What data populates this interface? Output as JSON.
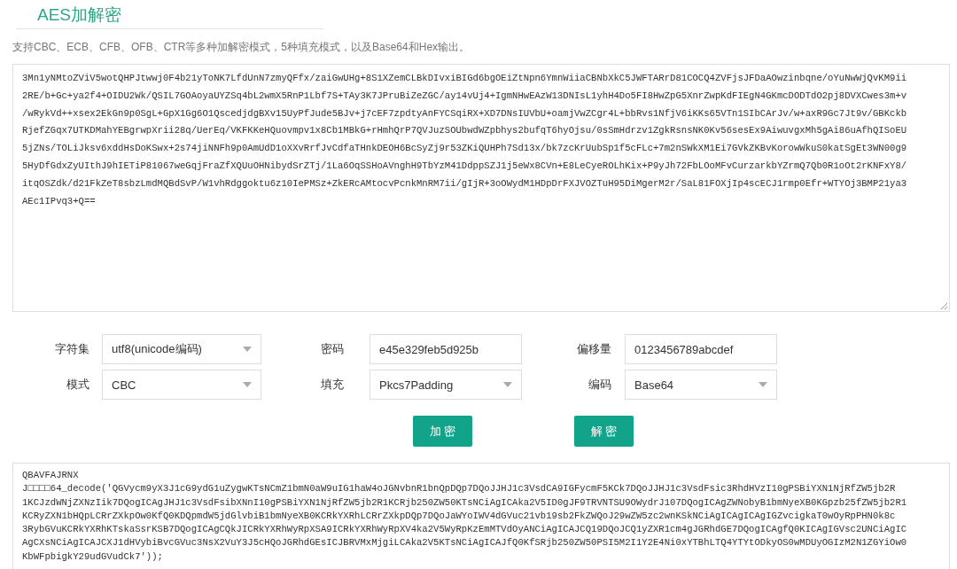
{
  "header": {
    "title": "AES加解密",
    "description": "支持CBC、ECB、CFB、OFB、CTR等多种加解密模式，5种填充模式，以及Base64和Hex输出。"
  },
  "input_text": [
    "3Mn1yNMtoZViV5wotQHPJtwwj0F4b21yToNK7LfdUnN7zmyQFfx/zaiGwUHg+8S1XZemCLBkDIvxiBIGd6bgOEiZtNpn6YmnWiiaCBNbXkC5JWFTARrD81COCQ4ZVFjsJFDaAOwzinbqne/oYuNwWjQvKM9ii",
    "2RE/b+Gc+ya2f4+OIDU2Wk/QSIL7GOAoyaUYZSq4bL2wmX5RnP1Lbf7S+TAy3K7JPruBiZeZGC/ay14vUj4+IgmNHwEAzW13DNIsL1yhH4Do5FI8HwZpG5XnrZwpKdFIEgN4GKmcDODTdO2pj8DVXCwes3m+v",
    "/wRykVd++xsex2EkGn9p0SgL+GpX1Gg6O1QscedjdgBXv15UyPfJude5BJv+j7cEF7zpdtyAnFYCSqiRX+XD7DNsIUVbU+oamjVwZCgr4L+bbRvs1NfjV6iKKs65VTn1SIbCArJv/w+axR9Gc7Jt9v/GBKckb",
    "RjefZGqx7UTKDMahYEBgrwpXrii28q/UerEq/VKFKKeHQuovmpv1x8Cb1MBkG+rHmhQrP7QVJuzSOUbwdWZpbhys2bufqT6hyOjsu/0sSmHdrzv1ZgkRsnsNK0Kv56sesEx9AiwuvgxMh5gAi86uAfhQISoEU",
    "5jZNs/TOLiJksv6xddHsDoKSwx+2s74jiNNFh9p0AmUdD1oXXvRrfJvCdfaTHnkDEOH6BcSyZj9r53ZKiQUHPh7Sd13x/bk7zcKrUubSp1f5cFLc+7m2nSWkXM1Ei7GVkZKBvKorowWkuS0katSgEt3WN00g9",
    "5HyDfGdxZyUIthJ9hIETiP81067weGqjFraZfXQUuOHNibydSrZTj/1La6OqSSHoAVnghH9TbYzM41DdppSZJ1j5eWx8CVn+E8LeCyeROLhKix+P9yJh72FbLOoMFvCurzarkbYZrmQ7Qb0R1oOt2rKNFxY8/",
    "itqOSZdk/d21FkZeT8sbzLmdMQBdSvP/W1vhRdggoktu6z10IePMSz+ZkERcAMtocvPcnkMnRM7ii/gIjR+3oOWydM1HDpDrFXJVOZTuH95DiMgerM2r/SaL81FOXjIp4scECJ1rmp0Efr+WTYOj3BMP21ya3",
    "AEc1IPvq3+Q=="
  ],
  "fields": [
    {
      "label": "字符集",
      "kind": "select",
      "value": "utf8(unicode编码)"
    },
    {
      "label": "密码",
      "kind": "input",
      "value": "e45e329feb5d925b"
    },
    {
      "label": "偏移量",
      "kind": "input",
      "value": "0123456789abcdef"
    },
    {
      "label": "模式",
      "kind": "select",
      "value": "CBC"
    },
    {
      "label": "填充",
      "kind": "select",
      "value": "Pkcs7Padding"
    },
    {
      "label": "编码",
      "kind": "select",
      "value": "Base64"
    }
  ],
  "buttons": [
    "加 密",
    "解 密"
  ],
  "output_text": [
    "QBAVFAJRNX",
    "J□□□□64_decode('QGVycm9yX3J1cG9ydG1uZygwKTsNCmZ1bmN0aW9uIG1haW4oJGNvbnR1bnQpDQp7DQoJJHJ1c3VsdCA9IGFycmF5KCk7DQoJJHJ1c3VsdFsic3RhdHVzI10gPSBiYXN1NjRfZW5jb2R",
    "1KCJzdWNjZXNzIik7DQogICAgJHJ1c3VsdFsibXNnI10gPSBiYXN1NjRfZW5jb2R1KCRjb250ZW50KTsNCiAgICAka2V5ID0gJF9TRVNTSU9OWydrJ107DQogICAgZWNobyB1bmNyeXB0KGpzb25fZW5jb2R1",
    "KCRyZXN1bHQpLCRrZXkpOw0KfQ0KDQpmdW5jdGlvbiB1bmNyeXB0KCRkYXRhLCRrZXkpDQp7DQoJaWYoIWV4dGVuc21vb19sb2FkZWQoJ29wZW5zc2wnKSkNCiAgICAgICAgIGZvcigkaT0wOyRpPHN0k8c",
    "3RybGVuKCRkYXRhKTskaSsrKSB7DQogICAgCQkJICRkYXRhWyRpXSA9ICRkYXRhWyRpXV4ka2V5WyRpKzEmMTVdOyANCiAgICAJCQ19DQoJCQ1yZXR1cm4gJGRhdGE7DQogICAgfQ0KICAgIGVsc2UNCiAgIC",
    "AgCXsNCiAgICAJCXJ1dHVybiBvcGVuc3NsX2VuY3J5cHQoJGRhdGEsICJBRVMxMjgiLCAka2V5KTsNCiAgICAJfQ0KfSRjb250ZW50PSI5M2I1Y2E4Ni0xYTBhLTQ4YTYtODkyOS0wMDUyOGIzM2N1ZGYiOw0",
    "KbWFpbigkY29udGVudCk7'));"
  ]
}
